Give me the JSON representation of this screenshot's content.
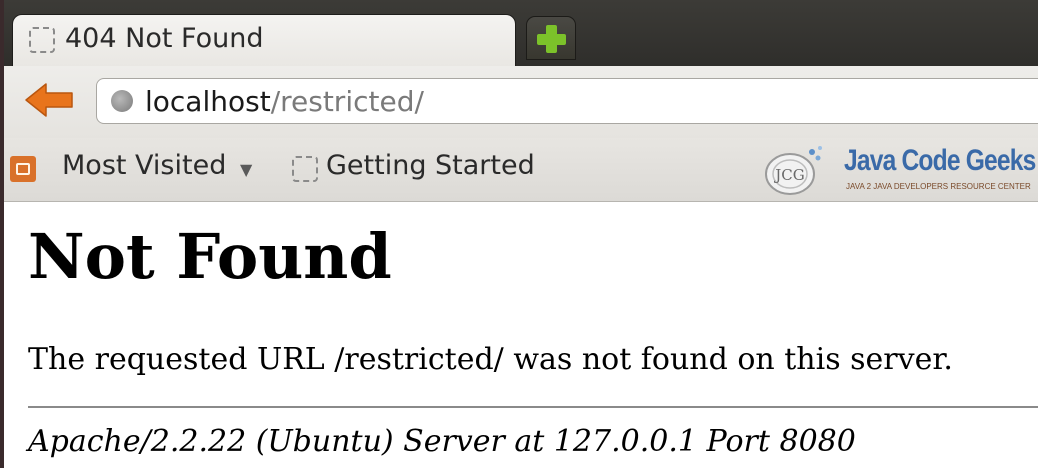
{
  "tab": {
    "title": "404 Not Found",
    "icon": "blank-page-icon"
  },
  "new_tab": {
    "icon": "plus-icon",
    "color": "#7cc22a"
  },
  "navigation": {
    "back_icon": "back-arrow-icon",
    "back_color": "#e8741c",
    "url_host": "localhost",
    "url_path": "/restricted/"
  },
  "bookmarks": {
    "items": [
      {
        "label": "Most Visited",
        "icon": "folder-icon",
        "has_dropdown": true
      },
      {
        "label": "Getting Started",
        "icon": "blank-page-icon"
      }
    ],
    "logo": {
      "title": "Java Code Geeks",
      "subtitle": "JAVA 2 JAVA DEVELOPERS RESOURCE CENTER",
      "mark": "JCG",
      "color": "#3a6aa8"
    }
  },
  "page": {
    "heading": "Not Found",
    "message": "The requested URL /restricted/ was not found on this server.",
    "address": "Apache/2.2.22 (Ubuntu) Server at 127.0.0.1 Port 8080"
  }
}
